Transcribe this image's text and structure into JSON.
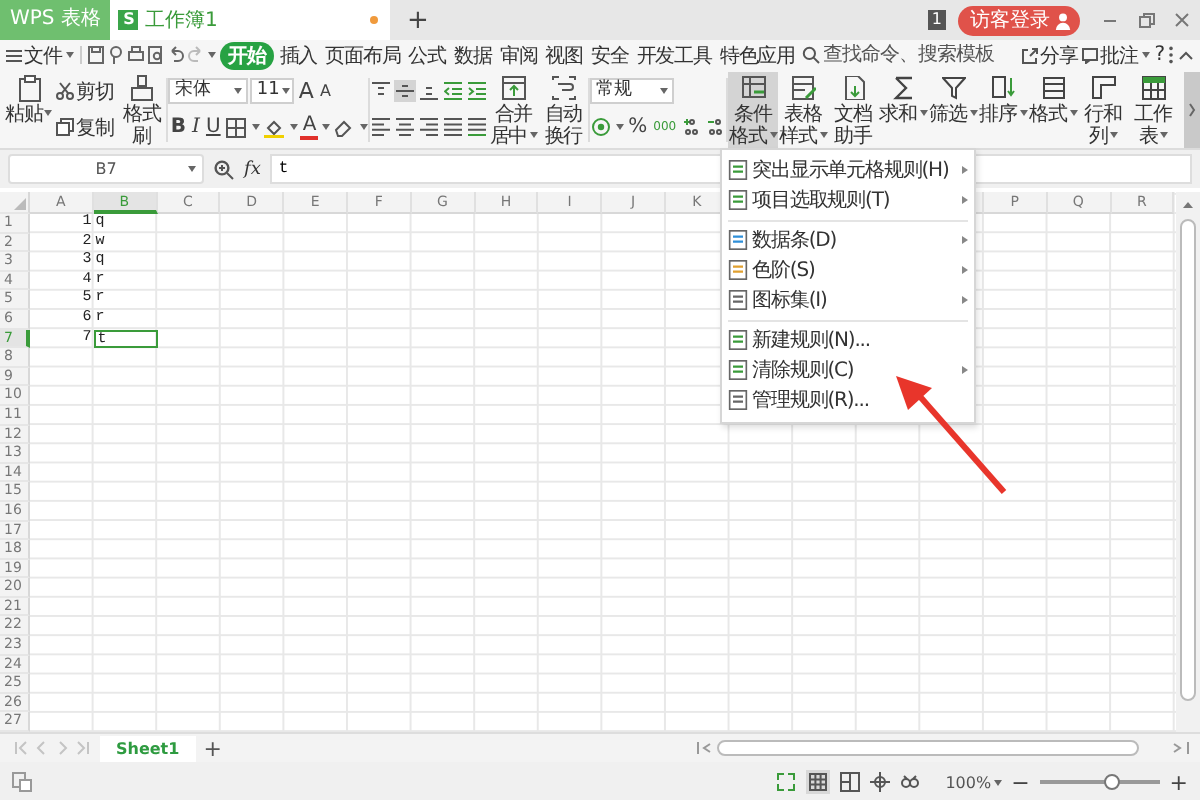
{
  "title_bar": {
    "app_tab": "WPS 表格",
    "document_tab": {
      "logo": "S",
      "title": "工作簿1",
      "unsaved": true
    },
    "new_tab": "+",
    "badge": "1",
    "login": "访客登录"
  },
  "menu": {
    "file": "文件",
    "tabs": [
      {
        "label": "开始",
        "selected": true
      },
      {
        "label": "插入",
        "selected": false
      },
      {
        "label": "页面布局",
        "selected": false
      },
      {
        "label": "公式",
        "selected": false
      },
      {
        "label": "数据",
        "selected": false
      },
      {
        "label": "审阅",
        "selected": false
      },
      {
        "label": "视图",
        "selected": false
      },
      {
        "label": "安全",
        "selected": false
      },
      {
        "label": "开发工具",
        "selected": false
      },
      {
        "label": "特色应用",
        "selected": false
      }
    ],
    "search": {
      "placeholder": "查找命令、搜索模板"
    },
    "share": "分享",
    "comment": "批注",
    "help": "?"
  },
  "ribbon": {
    "paste": "粘贴",
    "cut": "剪切",
    "copy": "复制",
    "format_painter": "格式刷",
    "font": "宋体",
    "font_size": "11",
    "grow_font": "A",
    "shrink_font": "A",
    "bold": "B",
    "italic": "I",
    "underline": "U",
    "font_color": "A",
    "vertical_alignment": [
      {
        "pressed": false
      },
      {
        "pressed": true
      },
      {
        "pressed": false
      }
    ],
    "merge": "合并居中",
    "wrap": "自动换行",
    "number_format": "常规",
    "percent": "%",
    "thousands": "000",
    "tools": [
      {
        "label": "条件格式",
        "pressed": true,
        "dropdown": true
      },
      {
        "label": "表格样式",
        "pressed": false,
        "dropdown": true
      },
      {
        "label": "文档助手",
        "pressed": false,
        "dropdown": false
      },
      {
        "label": "求和",
        "pressed": false,
        "dropdown": true
      },
      {
        "label": "筛选",
        "pressed": false,
        "dropdown": true
      },
      {
        "label": "排序",
        "pressed": false,
        "dropdown": true
      },
      {
        "label": "格式",
        "pressed": false,
        "dropdown": true
      },
      {
        "label": "行和列",
        "pressed": false,
        "dropdown": true
      },
      {
        "label": "工作表",
        "pressed": false,
        "dropdown": true
      }
    ]
  },
  "conditional_format_menu": {
    "sections": [
      [
        {
          "label": "突出显示单元格规则(H)",
          "submenu": true
        },
        {
          "label": "项目选取规则(T)",
          "submenu": true
        }
      ],
      [
        {
          "label": "数据条(D)",
          "submenu": true
        },
        {
          "label": "色阶(S)",
          "submenu": true
        },
        {
          "label": "图标集(I)",
          "submenu": true
        }
      ],
      [
        {
          "label": "新建规则(N)...",
          "submenu": false
        },
        {
          "label": "清除规则(C)",
          "submenu": true
        },
        {
          "label": "管理规则(R)...",
          "submenu": false
        }
      ]
    ]
  },
  "formula_bar": {
    "name_box": "B7",
    "function": "fx",
    "value": "t"
  },
  "sheet": {
    "columns": [
      {
        "label": "A",
        "selected": false
      },
      {
        "label": "B",
        "selected": true
      },
      {
        "label": "C",
        "selected": false
      },
      {
        "label": "D",
        "selected": false
      },
      {
        "label": "E",
        "selected": false
      },
      {
        "label": "F",
        "selected": false
      },
      {
        "label": "G",
        "selected": false
      },
      {
        "label": "H",
        "selected": false
      },
      {
        "label": "I",
        "selected": false
      },
      {
        "label": "J",
        "selected": false
      },
      {
        "label": "K",
        "selected": false
      },
      {},
      {},
      {},
      {},
      {
        "label": "P",
        "selected": false
      },
      {
        "label": "Q",
        "selected": false
      },
      {
        "label": "R",
        "selected": false
      }
    ],
    "rows": [
      {
        "label": "1",
        "selected": false,
        "cells": [
          "1",
          "q"
        ]
      },
      {
        "label": "2",
        "selected": false,
        "cells": [
          "2",
          "w"
        ]
      },
      {
        "label": "3",
        "selected": false,
        "cells": [
          "3",
          "q"
        ]
      },
      {
        "label": "4",
        "selected": false,
        "cells": [
          "4",
          "r"
        ]
      },
      {
        "label": "5",
        "selected": false,
        "cells": [
          "5",
          "r"
        ]
      },
      {
        "label": "6",
        "selected": false,
        "cells": [
          "6",
          "r"
        ]
      },
      {
        "label": "7",
        "selected": true,
        "cells": [
          "7",
          "t"
        ]
      },
      {
        "label": "8",
        "selected": false
      },
      {
        "label": "9",
        "selected": false
      },
      {
        "label": "10",
        "selected": false
      },
      {
        "label": "11",
        "selected": false
      },
      {
        "label": "12",
        "selected": false
      },
      {
        "label": "13",
        "selected": false
      },
      {
        "label": "14",
        "selected": false
      },
      {
        "label": "15",
        "selected": false
      },
      {
        "label": "16",
        "selected": false
      },
      {
        "label": "17",
        "selected": false
      },
      {
        "label": "18",
        "selected": false
      },
      {
        "label": "19",
        "selected": false
      },
      {
        "label": "20",
        "selected": false
      },
      {
        "label": "21",
        "selected": false
      },
      {
        "label": "22",
        "selected": false
      },
      {
        "label": "23",
        "selected": false
      },
      {
        "label": "24",
        "selected": false
      },
      {
        "label": "25",
        "selected": false
      },
      {
        "label": "26",
        "selected": false
      },
      {
        "label": "27",
        "selected": false
      }
    ]
  },
  "sheet_tabs": {
    "tabs": [
      {
        "label": "Sheet1",
        "selected": true
      }
    ],
    "add": "+"
  },
  "status_bar": {
    "zoom": "100%",
    "zoom_out": "−",
    "zoom_in": "+",
    "zoom_slider": {
      "level": 0.6
    }
  }
}
